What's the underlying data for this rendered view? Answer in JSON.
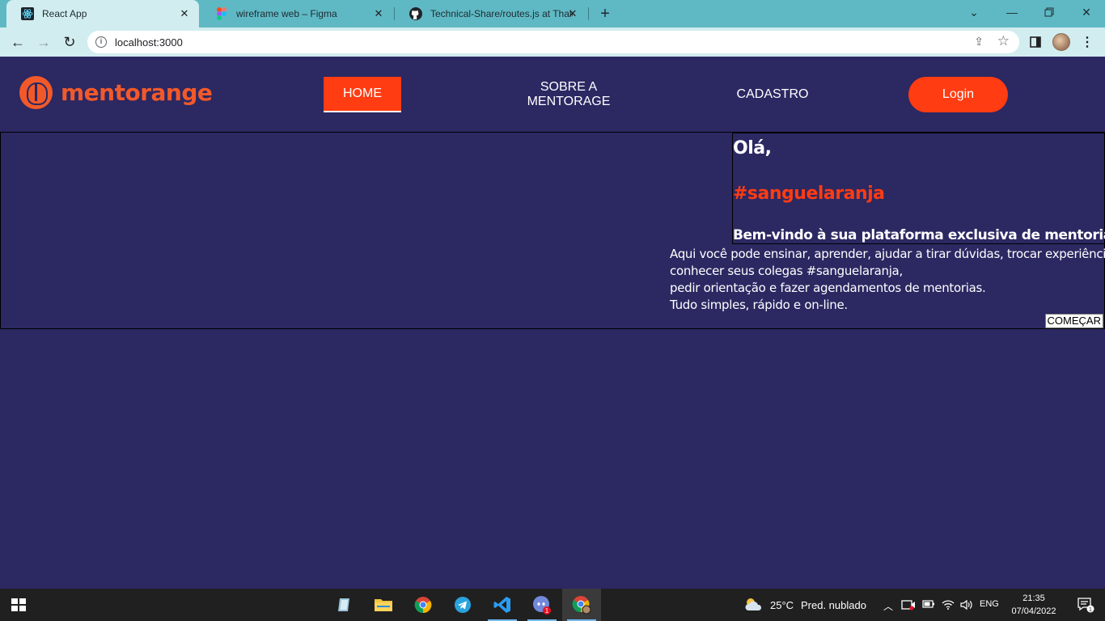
{
  "browser": {
    "tabs": [
      {
        "title": "React App",
        "icon": "react-icon",
        "active": true
      },
      {
        "title": "wireframe web – Figma",
        "icon": "figma-icon",
        "active": false
      },
      {
        "title": "Technical-Share/routes.js at Thalc",
        "icon": "github-icon",
        "active": false
      }
    ],
    "url": "localhost:3000"
  },
  "site": {
    "brand": "mentorange",
    "nav": {
      "home": "HOME",
      "sobre_line1": "SOBRE A",
      "sobre_line2": "MENTORAGE",
      "cadastro": "CADASTRO",
      "login": "Login"
    },
    "hero": {
      "greeting": "Olá,",
      "hashtag": "#sanguelaranja",
      "subtitle": "Bem-vindo à sua plataforma exclusiva de mentorias.",
      "lines": [
        "Aqui você pode ensinar, aprender, ajudar a tirar dúvidas, trocar experiências,",
        "conhecer seus colegas #sanguelaranja,",
        "pedir orientação e fazer agendamentos de mentorias.",
        "Tudo simples, rápido e on-line."
      ],
      "cta": "COMEÇAR"
    }
  },
  "taskbar": {
    "weather_temp": "25°C",
    "weather_desc": "Pred. nublado",
    "language": "ENG",
    "time": "21:35",
    "date": "07/04/2022",
    "discord_badge": "1",
    "notifications": "1"
  },
  "colors": {
    "page_bg": "#2b2862",
    "accent": "#ff3c12",
    "brand": "#f2592a",
    "chrome_tabstrip": "#5fb9c4",
    "chrome_toolbar": "#d2edf0"
  }
}
